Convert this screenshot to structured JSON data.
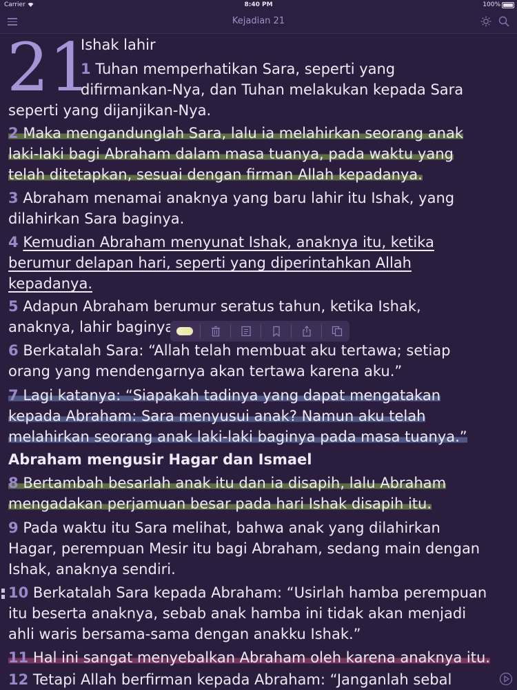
{
  "status_bar": {
    "carrier": "Carrier",
    "time": "8:40 PM",
    "battery": "100%"
  },
  "nav": {
    "title": "Kejadian 21"
  },
  "chapter": {
    "number": "21",
    "heading": "Ishak lahir"
  },
  "verses": {
    "v1": {
      "num": "1",
      "l1": "Tuhan memperhatikan Sara, seperti yang",
      "l2": "difirmankan-Nya, dan Tuhan melakukan kepada Sara",
      "l3": "seperti yang dijanjikan-Nya."
    },
    "v2": {
      "num": "2",
      "l1": "Maka mengandunglah Sara, lalu ia melahirkan seorang anak",
      "l2": "laki-laki bagi Abraham dalam masa tuanya, pada waktu yang",
      "l3": "telah ditetapkan, sesuai dengan firman Allah kepadanya."
    },
    "v3": {
      "num": "3",
      "l1": "Abraham menamai anaknya yang baru lahir itu Ishak, yang",
      "l2": "dilahirkan Sara baginya."
    },
    "v4": {
      "num": "4",
      "l1": "Kemudian Abraham menyunat Ishak, anaknya itu, ketika",
      "l2": "berumur delapan hari, seperti yang diperintahkan Allah",
      "l3": "kepadanya."
    },
    "v5": {
      "num": "5",
      "l1": "Adapun Abraham berumur seratus tahun, ketika Ishak,",
      "l2": "anaknya, lahir baginya."
    },
    "v6": {
      "num": "6",
      "l1": "Berkatalah Sara: “Allah telah membuat aku tertawa; setiap",
      "l2": "orang yang mendengarnya akan tertawa karena aku.”"
    },
    "v7": {
      "num": "7",
      "l1": "Lagi katanya: “Siapakah tadinya yang dapat mengatakan",
      "l2": "kepada Abraham: Sara menyusui anak? Namun aku telah",
      "l3": "melahirkan seorang anak laki-laki baginya pada masa tuanya.”"
    },
    "section2": "Abraham mengusir Hagar dan Ismael",
    "v8": {
      "num": "8",
      "l1": "Bertambah besarlah anak itu dan ia disapih, lalu Abraham",
      "l2": "mengadakan perjamuan besar pada hari Ishak disapih itu."
    },
    "v9": {
      "num": "9",
      "l1": "Pada waktu itu Sara melihat, bahwa anak yang dilahirkan",
      "l2": "Hagar, perempuan Mesir itu bagi Abraham, sedang main dengan",
      "l3": "Ishak, anaknya sendiri."
    },
    "v10": {
      "num": "10",
      "l1": "Berkatalah Sara kepada Abraham: “Usirlah hamba perempuan",
      "l2": "itu beserta anaknya, sebab anak hamba ini tidak akan menjadi",
      "l3": "ahli waris bersama-sama dengan anakku Ishak.”"
    },
    "v11": {
      "num": "11",
      "l1": "Hal ini sangat menyebalkan Abraham oleh karena anaknya itu."
    },
    "v12": {
      "num": "12",
      "l1": "Tetapi Allah berfirman kepada Abraham: “Janganlah sebal"
    }
  },
  "toolbar": {
    "icons": [
      "highlight-color-icon",
      "trash-icon",
      "note-icon",
      "bookmark-icon",
      "share-icon",
      "copy-icon"
    ]
  },
  "colors": {
    "background": "#2a1d3e",
    "accent": "#9a89c9",
    "highlight_green": "#78964a",
    "highlight_blue": "#5f6ea0",
    "highlight_pink": "#aa466e"
  }
}
